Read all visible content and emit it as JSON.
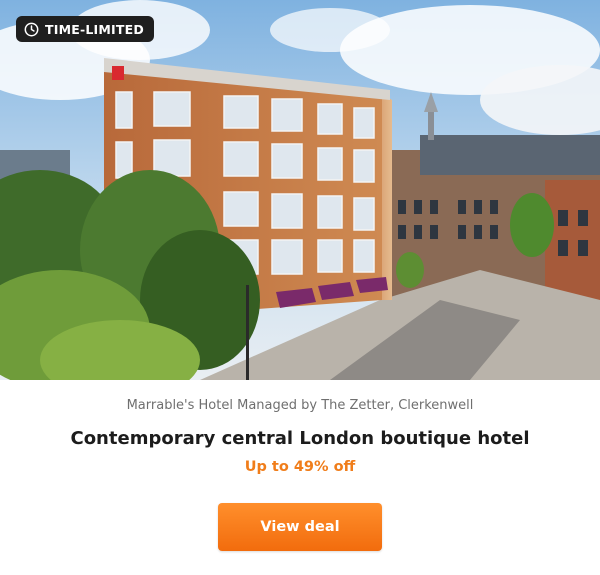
{
  "badge": {
    "label": "TIME-LIMITED",
    "icon": "clock-icon"
  },
  "hero": {
    "image_subject": "Hotel building photo"
  },
  "deal": {
    "hotel_name": "Marrable's Hotel Managed by The Zetter, Clerkenwell",
    "headline": "Contemporary central London boutique hotel",
    "discount": "Up to 49% off",
    "cta_label": "View deal"
  },
  "colors": {
    "accent": "#f07d1a",
    "button": "#f26c0d",
    "badge_bg": "#1f1f1f",
    "brick": "#c0763f",
    "awning": "#7a2a6a"
  }
}
